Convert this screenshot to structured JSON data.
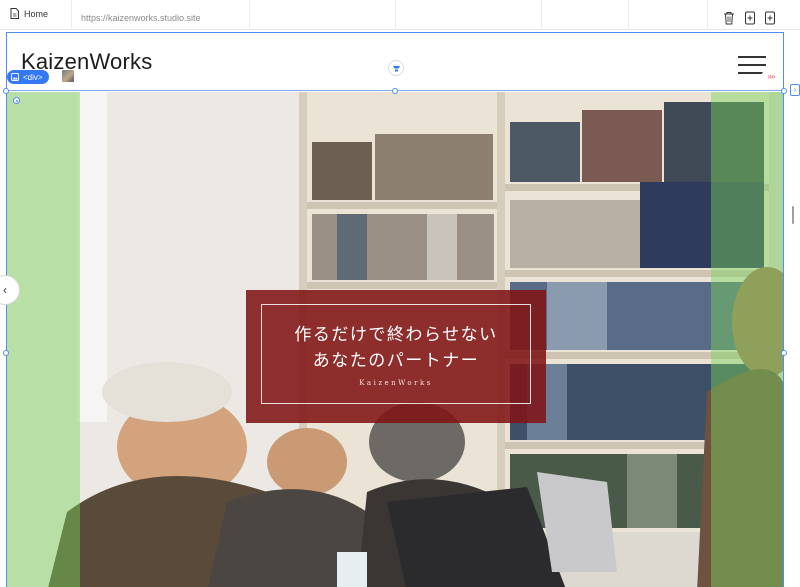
{
  "editor": {
    "page_name": "Home",
    "url": "https://kaizenworks.studio.site",
    "selection_badge": "<div>",
    "icons": {
      "page": "page-icon",
      "delete": "trash-icon",
      "add_before": "add-page-before-icon",
      "add_after": "add-page-after-icon",
      "collapse": "chevron-left-icon",
      "expand": "expand-right-icon",
      "arrows": "double-chevron-right-icon"
    },
    "accent_color": "#3478f6"
  },
  "site": {
    "logo": "KaizenWorks",
    "menu_icon": "hamburger-menu-icon",
    "hero": {
      "headline_line1": "作るだけで終わらせない",
      "headline_line2": "あなたのパートナー",
      "brand_sub": "KaizenWorks",
      "box_color": "#801416",
      "padding_overlay_color": "#78d25a"
    }
  }
}
